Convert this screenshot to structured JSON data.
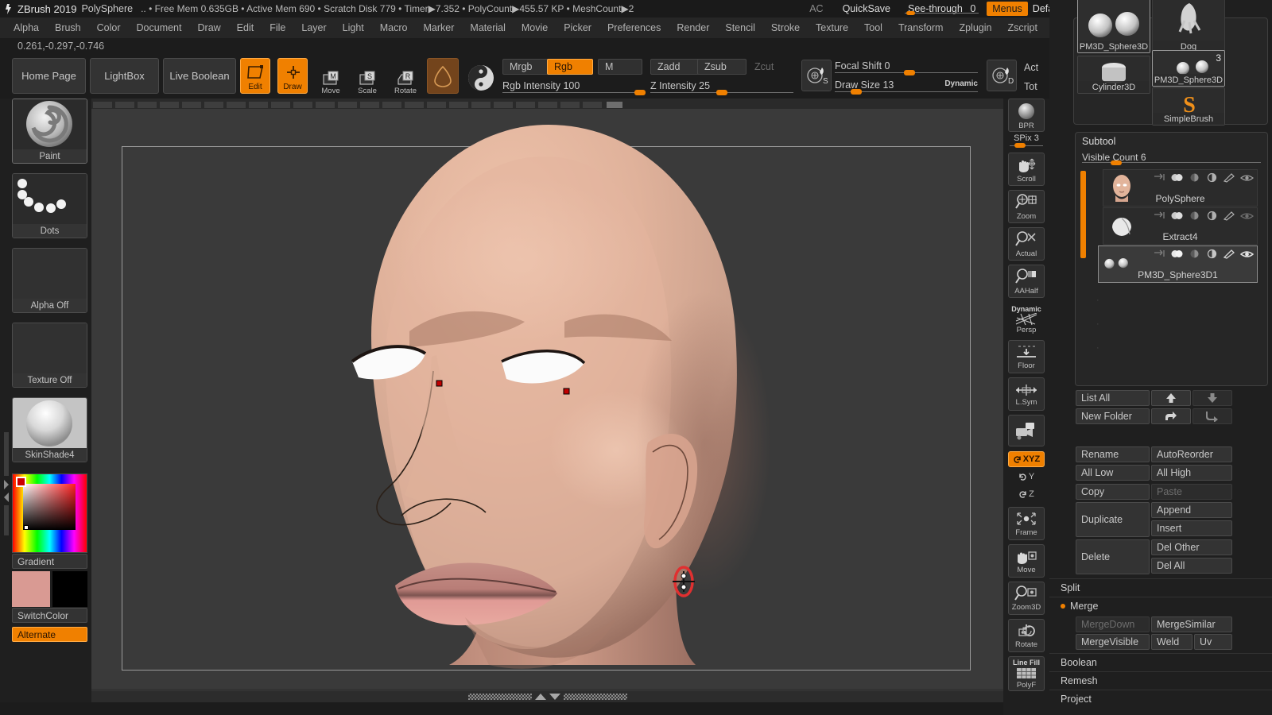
{
  "titlebar": {
    "app_title": "ZBrush 2019",
    "tool_name": "PolySphere",
    "stats": ".. • Free Mem 0.635GB • Active Mem 690 • Scratch Disk 779 • Timer▶7.352 • PolyCount▶455.57 KP • MeshCount▶2",
    "ac": "AC",
    "quicksave": "QuickSave",
    "see_through_label": "See-through",
    "see_through_value": "0",
    "menus": "Menus",
    "zscript": "DefaultZScript"
  },
  "menubar": {
    "items": [
      "Alpha",
      "Brush",
      "Color",
      "Document",
      "Draw",
      "Edit",
      "File",
      "Layer",
      "Light",
      "Macro",
      "Marker",
      "Material",
      "Movie",
      "Picker",
      "Preferences",
      "Render",
      "Stencil",
      "Stroke",
      "Texture",
      "Tool",
      "Transform",
      "Zplugin",
      "Zscript"
    ]
  },
  "coords": "0.261,-0.297,-0.746",
  "toolbar": {
    "home_page": "Home Page",
    "lightbox": "LightBox",
    "live_boolean": "Live Boolean",
    "edit": "Edit",
    "draw": "Draw",
    "move": "Move",
    "scale": "Scale",
    "rotate": "Rotate",
    "mrgb": "Mrgb",
    "rgb": "Rgb",
    "m": "M",
    "zadd": "Zadd",
    "zsub": "Zsub",
    "zcut": "Zcut",
    "rgb_intensity_label": "Rgb Intensity",
    "rgb_intensity_value": "100",
    "z_intensity_label": "Z Intensity",
    "z_intensity_value": "25",
    "focal_shift_label": "Focal Shift",
    "focal_shift_value": "0",
    "draw_size_label": "Draw Size",
    "draw_size_value": "13",
    "dynamic": "Dynamic",
    "act": "Act",
    "tot": "Tot"
  },
  "left_shelf": {
    "brush_label": "Paint",
    "stroke_label": "Dots",
    "alpha_label": "Alpha Off",
    "texture_label": "Texture Off",
    "material_label": "SkinShade4",
    "gradient_label": "Gradient",
    "switch_color_label": "SwitchColor",
    "alternate_label": "Alternate",
    "main_color": "#d99a93",
    "secondary_color": "#000000"
  },
  "right_toolbar": {
    "bpr": "BPR",
    "spix_label": "SPix",
    "spix_value": "3",
    "scroll": "Scroll",
    "zoom": "Zoom",
    "actual": "Actual",
    "aahalf": "AAHalf",
    "dynamic": "Dynamic",
    "persp": "Persp",
    "floor": "Floor",
    "lsym": "L.Sym",
    "xyz": "XYZ",
    "y_axis": "Y",
    "z_axis": "Z",
    "frame": "Frame",
    "move": "Move",
    "zoom3d": "Zoom3D",
    "rotate": "Rotate",
    "line_fill": "Line Fill",
    "polyf": "PolyF"
  },
  "tool_grid": {
    "cells": [
      {
        "name": "PM3D_Sphere3D",
        "badge": "",
        "selected": true,
        "icon": "two-spheres"
      },
      {
        "name": "Dog",
        "badge": "",
        "selected": false,
        "icon": "dog"
      },
      {
        "name": "PM3D_Sphere3D",
        "badge": "3",
        "selected": true,
        "icon": "two-small-spheres"
      },
      {
        "name": "Cylinder3D",
        "badge": "",
        "selected": false,
        "icon": "cylinder"
      },
      {
        "name": "SimpleBrush",
        "badge": "",
        "selected": false,
        "icon": "simple-brush"
      }
    ]
  },
  "subtool": {
    "title": "Subtool",
    "visible_count_label": "Visible Count",
    "visible_count_value": "6",
    "rows": [
      {
        "name": "PolySphere",
        "selected": false,
        "thumb": "head"
      },
      {
        "name": "Extract4",
        "selected": false,
        "thumb": "cap"
      },
      {
        "name": "PM3D_Sphere3D1",
        "selected": true,
        "thumb": "spheres"
      }
    ],
    "list_all": "List All",
    "new_folder": "New Folder",
    "rename": "Rename",
    "auto_reorder": "AutoReorder",
    "all_low": "All Low",
    "all_high": "All High",
    "copy": "Copy",
    "paste": "Paste",
    "duplicate": "Duplicate",
    "append": "Append",
    "insert": "Insert",
    "delete": "Delete",
    "del_other": "Del Other",
    "del_all": "Del All",
    "split": "Split",
    "merge": "Merge",
    "merge_down": "MergeDown",
    "merge_similar": "MergeSimilar",
    "merge_visible": "MergeVisible",
    "weld": "Weld",
    "uv": "Uv",
    "boolean": "Boolean",
    "remesh": "Remesh",
    "project": "Project"
  },
  "colors": {
    "accent": "#f08000",
    "panel_bg": "#1f1f1f",
    "canvas_bg": "#3a3a3a",
    "skin": "#d9a58f"
  }
}
